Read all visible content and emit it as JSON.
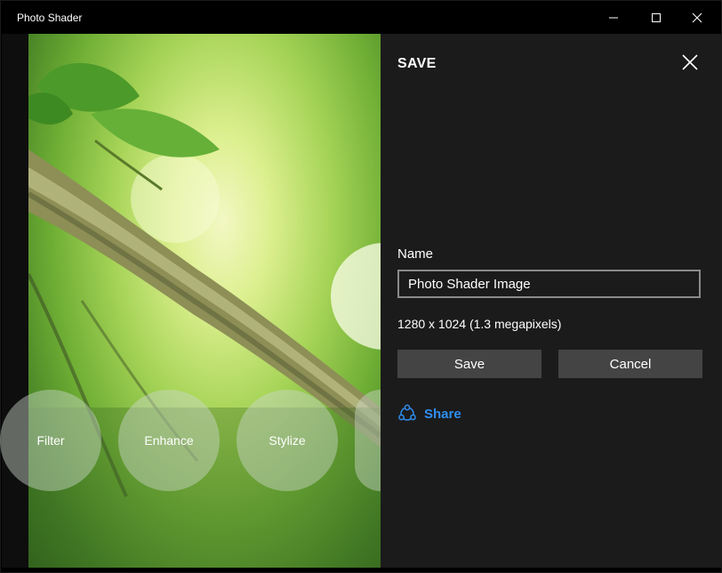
{
  "window": {
    "title": "Photo Shader",
    "controls": {
      "minimize": "minimize",
      "maximize": "maximize",
      "close": "close"
    }
  },
  "editor": {
    "tools": [
      {
        "label": "Filter"
      },
      {
        "label": "Enhance"
      },
      {
        "label": "Stylize"
      },
      {
        "label": ""
      }
    ]
  },
  "save_panel": {
    "title": "SAVE",
    "name_label": "Name",
    "name_value": "Photo Shader Image",
    "dimensions": "1280 x 1024 (1.3 megapixels)",
    "save_label": "Save",
    "cancel_label": "Cancel",
    "share_label": "Share"
  },
  "colors": {
    "accent": "#2f8ef0",
    "panel_bg": "#1b1b1b",
    "button_bg": "#444444"
  }
}
